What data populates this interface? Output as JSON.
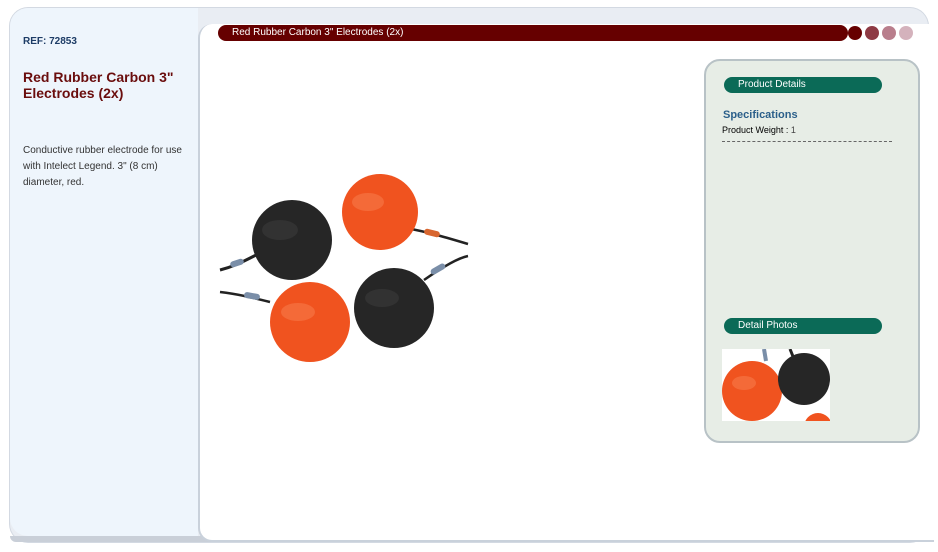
{
  "ref": "REF: 72853",
  "product_title": "Red Rubber Carbon 3\" Electrodes (2x)",
  "description": "Conductive rubber electrode for use with Intelect Legend. 3\" (8 cm) diameter, red.",
  "title_bar": "Red Rubber Carbon 3\" Electrodes (2x)",
  "panel": {
    "details_label": "Product Details",
    "spec_heading": "Specifications",
    "spec_key": "Product Weight :",
    "spec_value": "1",
    "photos_label": "Detail Photos"
  },
  "colors": {
    "brand_dark_red": "#660000",
    "accent_green": "#0b6a57",
    "electrode_red": "#f0531f",
    "electrode_black": "#2a2a2a"
  }
}
